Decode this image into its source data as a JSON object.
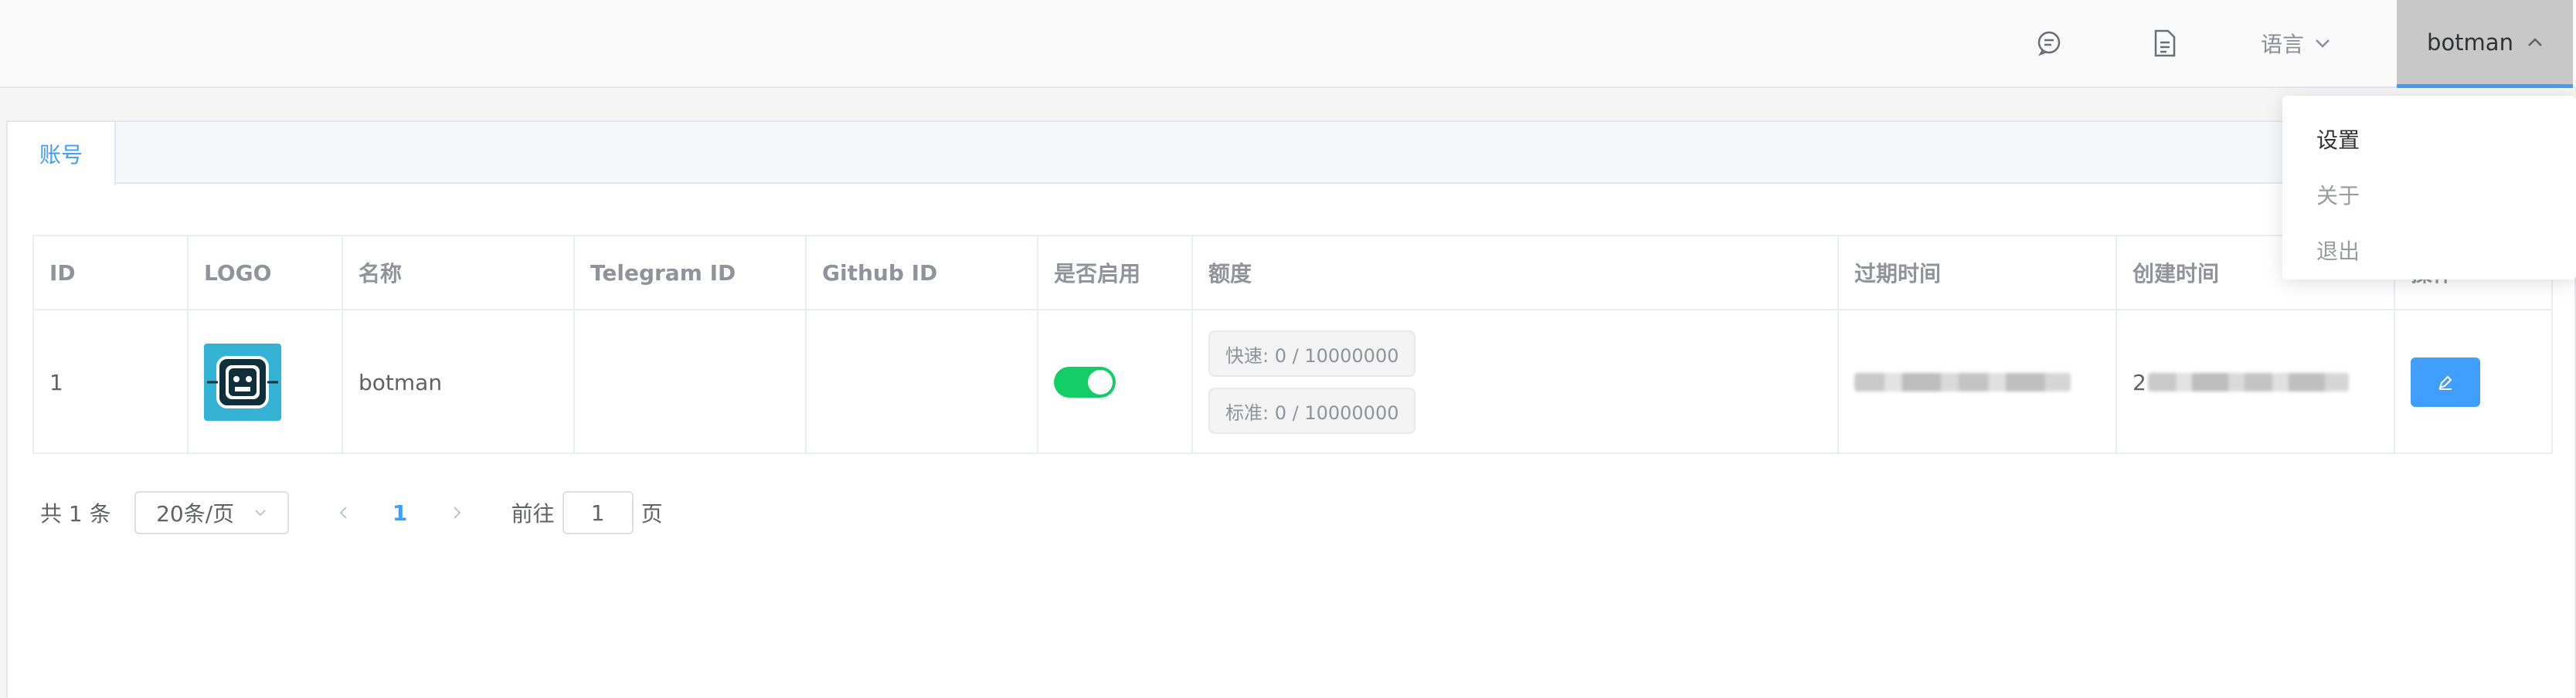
{
  "header": {
    "chat_icon": "chat-bubble-icon",
    "doc_icon": "document-icon",
    "language_label": "语言",
    "user_label": "botman"
  },
  "user_menu": {
    "items": [
      "设置",
      "关于",
      "退出"
    ]
  },
  "tabs": [
    {
      "label": "账号"
    }
  ],
  "table": {
    "columns": [
      "ID",
      "LOGO",
      "名称",
      "Telegram ID",
      "Github ID",
      "是否启用",
      "额度",
      "过期时间",
      "创建时间",
      "操作"
    ],
    "rows": [
      {
        "id": "1",
        "name": "botman",
        "telegram_id": "",
        "github_id": "",
        "enabled": true,
        "quota_fast": "快速: 0 / 10000000",
        "quota_standard": "标准: 0 / 10000000",
        "created_prefix": "2"
      }
    ]
  },
  "pagination": {
    "total_label": "共 1 条",
    "page_size": "20条/页",
    "current_page": "1",
    "goto_prefix": "前往",
    "goto_value": "1",
    "goto_suffix": "页"
  },
  "colors": {
    "accent": "#409eff",
    "switch_on": "#13ce66"
  }
}
